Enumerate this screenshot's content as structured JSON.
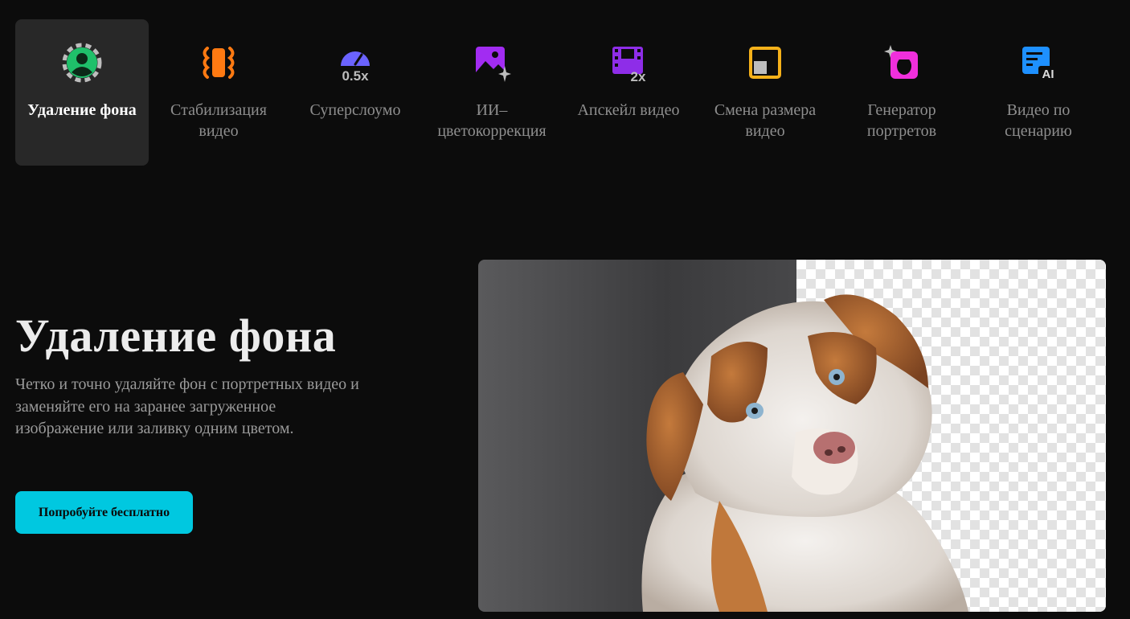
{
  "tabs": [
    {
      "label": "Удаление фона",
      "icon": "person-cutout-icon",
      "active": true,
      "color": "#1fc06a"
    },
    {
      "label": "Стабилизация видео",
      "icon": "stabilize-icon",
      "active": false,
      "color": "#ff7a12"
    },
    {
      "label": "Суперслоумо",
      "icon": "slow-motion-icon",
      "active": false,
      "color": "#6b63ff",
      "badge": "0.5x"
    },
    {
      "label": "ИИ–цветокоррекция",
      "icon": "ai-color-image-icon",
      "active": false,
      "color": "#a22cf2"
    },
    {
      "label": "Апскейл видео",
      "icon": "upscale-film-icon",
      "active": false,
      "color": "#8e2de8",
      "badge": "2x"
    },
    {
      "label": "Смена размера видео",
      "icon": "resize-icon",
      "active": false,
      "color": "#f5b11a"
    },
    {
      "label": "Генератор портретов",
      "icon": "portrait-generator-icon",
      "active": false,
      "color": "#f02fdc"
    },
    {
      "label": "Видео по сценарию",
      "icon": "script-to-video-icon",
      "active": false,
      "color": "#1e90ff",
      "badge": "AI"
    }
  ],
  "hero": {
    "title": "Удаление фона",
    "description": "Четко и точно удаляйте фон с портретных видео и заменяйте его на заранее загруженное изображение или заливку одним цветом.",
    "cta_label": "Попробуйте бесплатно"
  },
  "colors": {
    "background": "#0c0c0c",
    "accent": "#00c8e0",
    "active_tab": "#282828"
  }
}
